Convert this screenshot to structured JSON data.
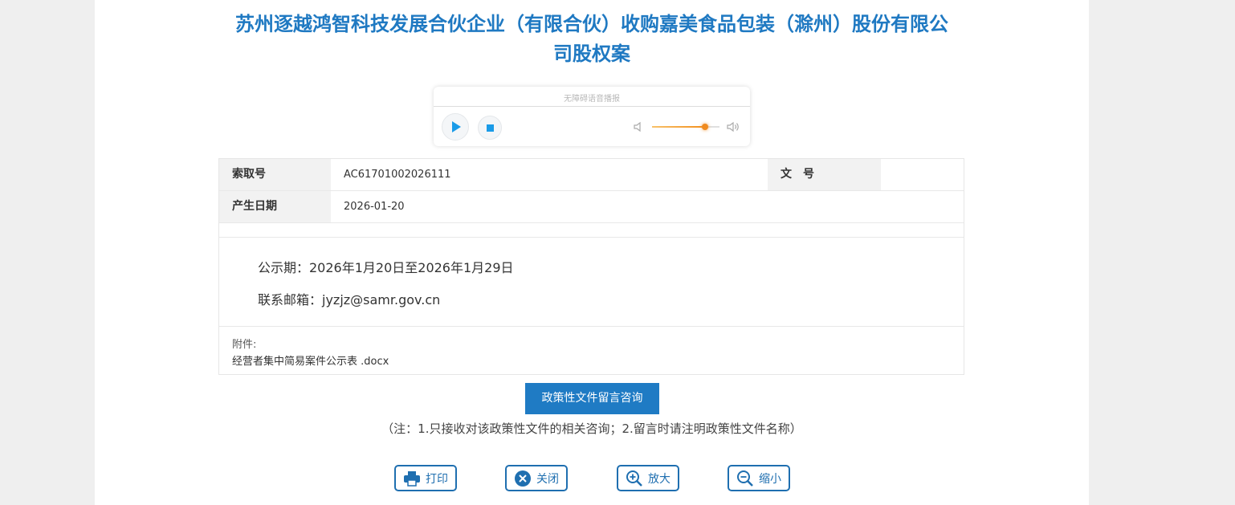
{
  "title_line1": "苏州逐越鸿智科技发展合伙企业（有限合伙）收购嘉美食品包装（滁州）股份有限公",
  "title_line2": "司股权案",
  "player": {
    "label": "无障碍语音播报",
    "volume_percent": 78
  },
  "info": {
    "index_label": "索取号",
    "index_value": "AC61701002026111",
    "doc_no_label": "文　号",
    "doc_no_value": "",
    "date_label": "产生日期",
    "date_value": "2026-01-20"
  },
  "body": {
    "line1": "公示期：2026年1月20日至2026年1月29日",
    "line2": "联系邮箱：jyzjz@samr.gov.cn"
  },
  "attachment": {
    "label": "附件:",
    "file": "经营者集中简易案件公示表 .docx"
  },
  "consult_button": "政策性文件留言咨询",
  "note": "（注：1.只接收对该政策性文件的相关咨询；2.留言时请注明政策性文件名称）",
  "tools": {
    "print": "打印",
    "close": "关闭",
    "zoom_in": "放大",
    "zoom_out": "缩小"
  },
  "colors": {
    "title": "#1f79c2",
    "accent": "#1f7bc4",
    "volume": "#f08a1e"
  }
}
